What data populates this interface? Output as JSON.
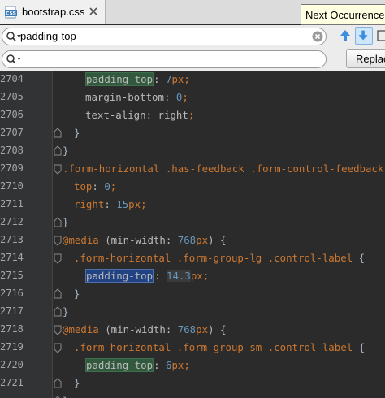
{
  "tab": {
    "filename": "bootstrap.css",
    "icon": "css-file-icon",
    "close_icon": "close-icon"
  },
  "tooltip": {
    "text": "Next Occurrence"
  },
  "search": {
    "find_value": "padding-top",
    "replace_value": "",
    "replace_button": "Replac"
  },
  "colors": {
    "selector": "#cc7832",
    "property": "#bababa",
    "number": "#6897bb",
    "match_highlight": "#32593d",
    "current_match": "#214283",
    "background": "#2b2b2b"
  },
  "editor": {
    "lines": [
      {
        "num": "2704",
        "parts": [
          [
            "hl",
            "padding-top"
          ],
          [
            "p",
            ": "
          ],
          [
            "n",
            "7"
          ],
          [
            "u",
            "px"
          ],
          [
            "pu",
            ";"
          ]
        ]
      },
      {
        "num": "2705",
        "parts": [
          [
            "p",
            "margin-bottom"
          ],
          [
            "p",
            ": "
          ],
          [
            "n",
            "0"
          ],
          [
            "pu",
            ";"
          ]
        ]
      },
      {
        "num": "2706",
        "parts": [
          [
            "p",
            "text-align"
          ],
          [
            "p",
            ": right"
          ],
          [
            "pu",
            ";"
          ]
        ]
      },
      {
        "num": "2707",
        "parts": [
          [
            "b",
            "}"
          ]
        ]
      },
      {
        "num": "2708",
        "parts": [
          [
            "b",
            "}"
          ]
        ]
      },
      {
        "num": "2709",
        "parts": [
          [
            "s",
            ".form-horizontal .has-feedback .form-control-feedback"
          ],
          [
            "b",
            " {"
          ]
        ]
      },
      {
        "num": "2710",
        "parts": [
          [
            "s",
            "top"
          ],
          [
            "p",
            ": "
          ],
          [
            "n",
            "0"
          ],
          [
            "pu",
            ";"
          ]
        ]
      },
      {
        "num": "2711",
        "parts": [
          [
            "s",
            "right"
          ],
          [
            "p",
            ": "
          ],
          [
            "n",
            "15"
          ],
          [
            "u",
            "px"
          ],
          [
            "pu",
            ";"
          ]
        ]
      },
      {
        "num": "2712",
        "parts": [
          [
            "b",
            "}"
          ]
        ]
      },
      {
        "num": "2713",
        "parts": [
          [
            "k",
            "@media"
          ],
          [
            "p",
            " (min-width: "
          ],
          [
            "n",
            "768"
          ],
          [
            "u",
            "px"
          ],
          [
            "p",
            ")"
          ],
          [
            "b",
            " {"
          ]
        ]
      },
      {
        "num": "2714",
        "parts": [
          [
            "s",
            ".form-horizontal .form-group-lg .control-label"
          ],
          [
            "b",
            " {"
          ]
        ]
      },
      {
        "num": "2715",
        "parts": [
          [
            "hs",
            "padding-top"
          ],
          [
            "c",
            ""
          ],
          [
            "p",
            ": "
          ],
          [
            "hn",
            "14.3"
          ],
          [
            "u",
            "px"
          ],
          [
            "pu",
            ";"
          ]
        ]
      },
      {
        "num": "2716",
        "parts": [
          [
            "b",
            "}"
          ]
        ]
      },
      {
        "num": "2717",
        "parts": [
          [
            "b",
            "}"
          ]
        ]
      },
      {
        "num": "2718",
        "parts": [
          [
            "k",
            "@media"
          ],
          [
            "p",
            " (min-width: "
          ],
          [
            "n",
            "768"
          ],
          [
            "u",
            "px"
          ],
          [
            "p",
            ")"
          ],
          [
            "b",
            " {"
          ]
        ]
      },
      {
        "num": "2719",
        "parts": [
          [
            "s",
            ".form-horizontal .form-group-sm .control-label"
          ],
          [
            "b",
            " {"
          ]
        ]
      },
      {
        "num": "2720",
        "parts": [
          [
            "hl",
            "padding-top"
          ],
          [
            "p",
            ": "
          ],
          [
            "n",
            "6"
          ],
          [
            "u",
            "px"
          ],
          [
            "pu",
            ";"
          ]
        ]
      },
      {
        "num": "2721",
        "parts": [
          [
            "b",
            "}"
          ]
        ]
      },
      {
        "num": "",
        "parts": [
          [
            "b",
            "}"
          ]
        ]
      }
    ]
  }
}
